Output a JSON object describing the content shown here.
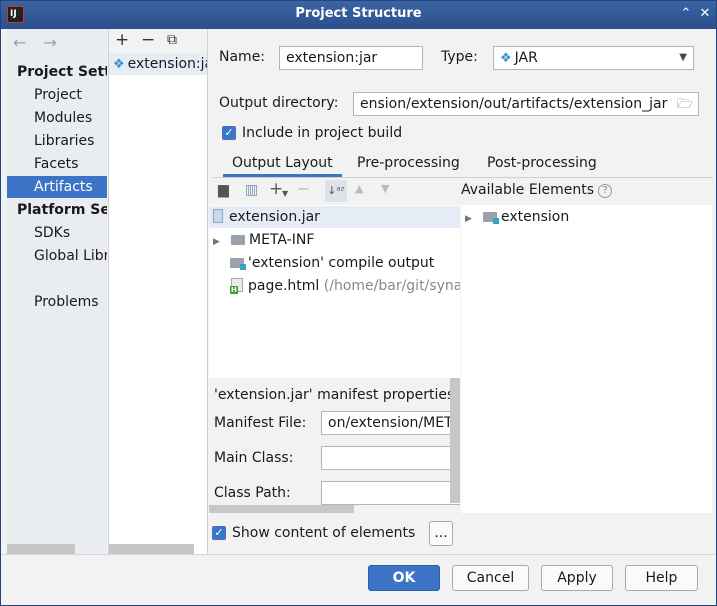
{
  "window": {
    "title": "Project Structure",
    "app_icon": "intellij-icon"
  },
  "titlebar_buttons": {
    "up": "⌃",
    "close": "✕"
  },
  "nav": {
    "back": "←",
    "forward": "→",
    "project_settings_heading": "Project Settings",
    "project_settings_items": [
      "Project",
      "Modules",
      "Libraries",
      "Facets",
      "Artifacts"
    ],
    "platform_settings_heading": "Platform Settings",
    "platform_settings_items": [
      "SDKs",
      "Global Libraries"
    ],
    "problems": "Problems",
    "selected": "Artifacts"
  },
  "artifact_list": {
    "add": "+",
    "remove": "−",
    "copy": "⧉",
    "items": [
      "extension:jar"
    ]
  },
  "artifact": {
    "name_label": "Name:",
    "name_value": "extension:jar",
    "type_label": "Type:",
    "type_value": "JAR",
    "output_dir_label": "Output directory:",
    "output_dir_value": "ension/extension/out/artifacts/extension_jar",
    "include_in_build_label": "Include in project build",
    "include_in_build_checked": true
  },
  "tabs": [
    "Output Layout",
    "Pre-processing",
    "Post-processing"
  ],
  "active_tab": "Output Layout",
  "output_tree": [
    {
      "label": "extension.jar",
      "icon": "jar-icon",
      "selected": true
    },
    {
      "label": "META-INF",
      "icon": "folder-icon",
      "expandable": true
    },
    {
      "label": "'extension' compile output",
      "icon": "source-folder-icon"
    },
    {
      "label": "page.html",
      "path": "(/home/bar/git/synat",
      "icon": "html-file-icon"
    }
  ],
  "manifest": {
    "heading": "'extension.jar' manifest properties:",
    "file_label": "Manifest File:",
    "file_value": "on/extension/META-INF",
    "main_class_label": "Main Class:",
    "main_class_value": "",
    "class_path_label": "Class Path:",
    "class_path_value": ""
  },
  "available": {
    "heading": "Available Elements",
    "items": [
      {
        "label": "extension",
        "icon": "module-folder-icon",
        "expandable": true
      }
    ]
  },
  "show_content_label": "Show content of elements",
  "show_content_checked": true,
  "ellipsis": "...",
  "buttons": {
    "ok": "OK",
    "cancel": "Cancel",
    "apply": "Apply",
    "help": "Help"
  },
  "colors": {
    "accent": "#3e74c8",
    "titlebar": "#2b4f8c"
  }
}
